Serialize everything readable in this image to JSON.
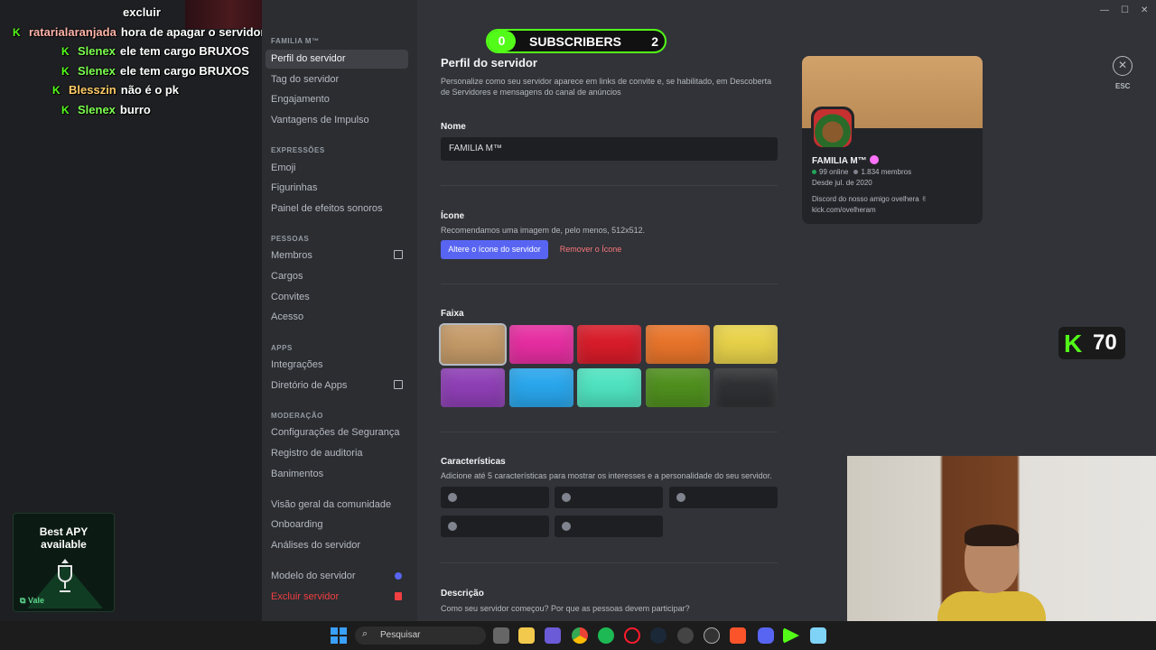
{
  "chat": [
    {
      "user": "",
      "msg": "excluir",
      "user_color": "#ffffff",
      "badge": false
    },
    {
      "user": "ratarialaranjada",
      "msg": "hora de apagar o servidor",
      "user_color": "#ffb3a8",
      "badge": true
    },
    {
      "user": "Slenex",
      "msg": "ele tem cargo BRUXOS",
      "user_color": "#7cff4f",
      "badge": true
    },
    {
      "user": "Slenex",
      "msg": "ele tem cargo BRUXOS",
      "user_color": "#7cff4f",
      "badge": true
    },
    {
      "user": "Blesszin",
      "msg": "não é o pk",
      "user_color": "#ffcc66",
      "badge": true
    },
    {
      "user": "Slenex",
      "msg": "burro",
      "user_color": "#7cff4f",
      "badge": true
    }
  ],
  "ad": {
    "title": "Best APY available",
    "brand": "Vale"
  },
  "subs_widget": {
    "left_count": "0",
    "label": "SUBSCRIBERS",
    "right_count": "2"
  },
  "kick_badge": {
    "count": "70"
  },
  "sidebar": {
    "server_name": "FAMILIA M™",
    "items_top": [
      "Perfil do servidor",
      "Tag do servidor",
      "Engajamento",
      "Vantagens de Impulso"
    ],
    "sec_expressoes": "EXPRESSÕES",
    "items_expr": [
      "Emoji",
      "Figurinhas",
      "Painel de efeitos sonoros"
    ],
    "sec_pessoas": "PESSOAS",
    "items_people": [
      "Membros",
      "Cargos",
      "Convites",
      "Acesso"
    ],
    "sec_apps": "APPS",
    "items_apps": [
      "Integrações",
      "Diretório de Apps"
    ],
    "sec_moderacao": "MODERAÇÃO",
    "items_mod": [
      "Configurações de Segurança",
      "Registro de auditoria",
      "Banimentos"
    ],
    "items_comm": [
      "Visão geral da comunidade",
      "Onboarding",
      "Análises do servidor"
    ],
    "template": "Modelo do servidor",
    "delete": "Excluir servidor"
  },
  "main": {
    "title": "Perfil do servidor",
    "subtitle_1": "Personalize como seu servidor aparece em links de convite e, se habilitado, em Descoberta",
    "subtitle_2": "de Servidores e mensagens do canal de anúncios",
    "name_label": "Nome",
    "name_value": "FAMILIA M™",
    "icon_label": "Ícone",
    "icon_hint": "Recomendamos uma imagem de, pelo menos, 512x512.",
    "change_icon": "Altere o ícone do servidor",
    "remove_icon": "Remover o Ícone",
    "banner_label": "Faixa",
    "traits_label": "Características",
    "traits_hint": "Adicione até 5 características para mostrar os interesses e a personalidade do seu servidor.",
    "desc_label": "Descrição",
    "desc_hint": "Como seu servidor começou? Por que as pessoas devem participar?"
  },
  "swatches": [
    "#c49a68",
    "#e62ea1",
    "#d81c2a",
    "#e8742a",
    "#e8d24a",
    "#8e3fb5",
    "#29a6ec",
    "#4fe3c0",
    "#4f8f1e",
    "#2f3033"
  ],
  "preview": {
    "name": "FAMILIA M™",
    "online": "99 online",
    "members": "1.834 membros",
    "since": "Desde jul. de 2020",
    "desc_1": "Discord do nosso amigo ovelhera ✌",
    "desc_2": "kick.com/ovelheram"
  },
  "close_label": "ESC",
  "taskbar": {
    "search_placeholder": "Pesquisar"
  }
}
